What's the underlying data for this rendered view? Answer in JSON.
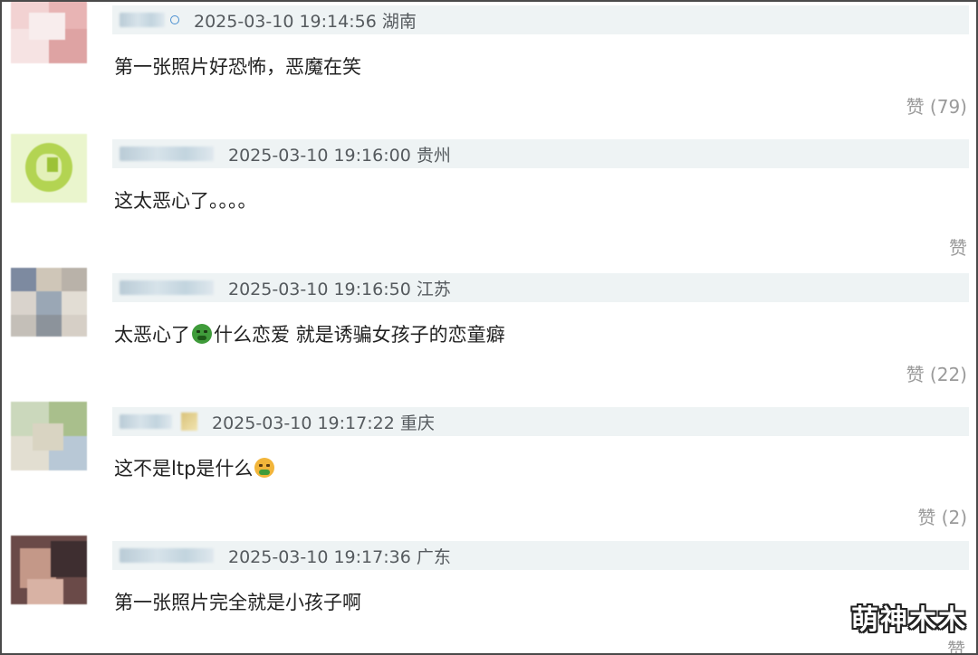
{
  "comments": [
    {
      "meta": "2025-03-10 19:14:56 湖南",
      "content": "第一张照片好恐怖，恶魔在笑",
      "like": "赞 (79)",
      "avatar_colors": [
        "#f3d4d4",
        "#e9b5b5",
        "#f7e3e3",
        "#d99a9a"
      ]
    },
    {
      "meta": "2025-03-10 19:16:00 贵州",
      "content": "这太恶心了。。。。",
      "like": "赞",
      "avatar_colors": [
        "#e9f4c8",
        "#b7d65a",
        "#cfe58a",
        "#9fc43a"
      ]
    },
    {
      "meta": "2025-03-10 19:16:50 江苏",
      "content_before": "太恶心了",
      "emoji": "nauseated-face",
      "content_after": "什么恋爱 就是诱骗女孩子的恋童癖",
      "like": "赞 (22)",
      "avatar_colors": [
        "#c7c9cc",
        "#a9b6c4",
        "#d9d2c7",
        "#8a8f96"
      ]
    },
    {
      "meta": "2025-03-10 19:17:22 重庆",
      "content_before": "这不是ltp是什么",
      "emoji": "vomiting-face",
      "like": "赞 (2)",
      "avatar_colors": [
        "#d8e3c9",
        "#b5c99a",
        "#a7b8c7",
        "#e4e0d3"
      ]
    },
    {
      "meta": "2025-03-10 19:17:36 广东",
      "content": "第一张照片完全就是小孩子啊",
      "like": "赞",
      "avatar_colors": [
        "#7a5450",
        "#b88a80",
        "#4a3638",
        "#d1a79c"
      ]
    }
  ],
  "watermark": "萌神木木"
}
